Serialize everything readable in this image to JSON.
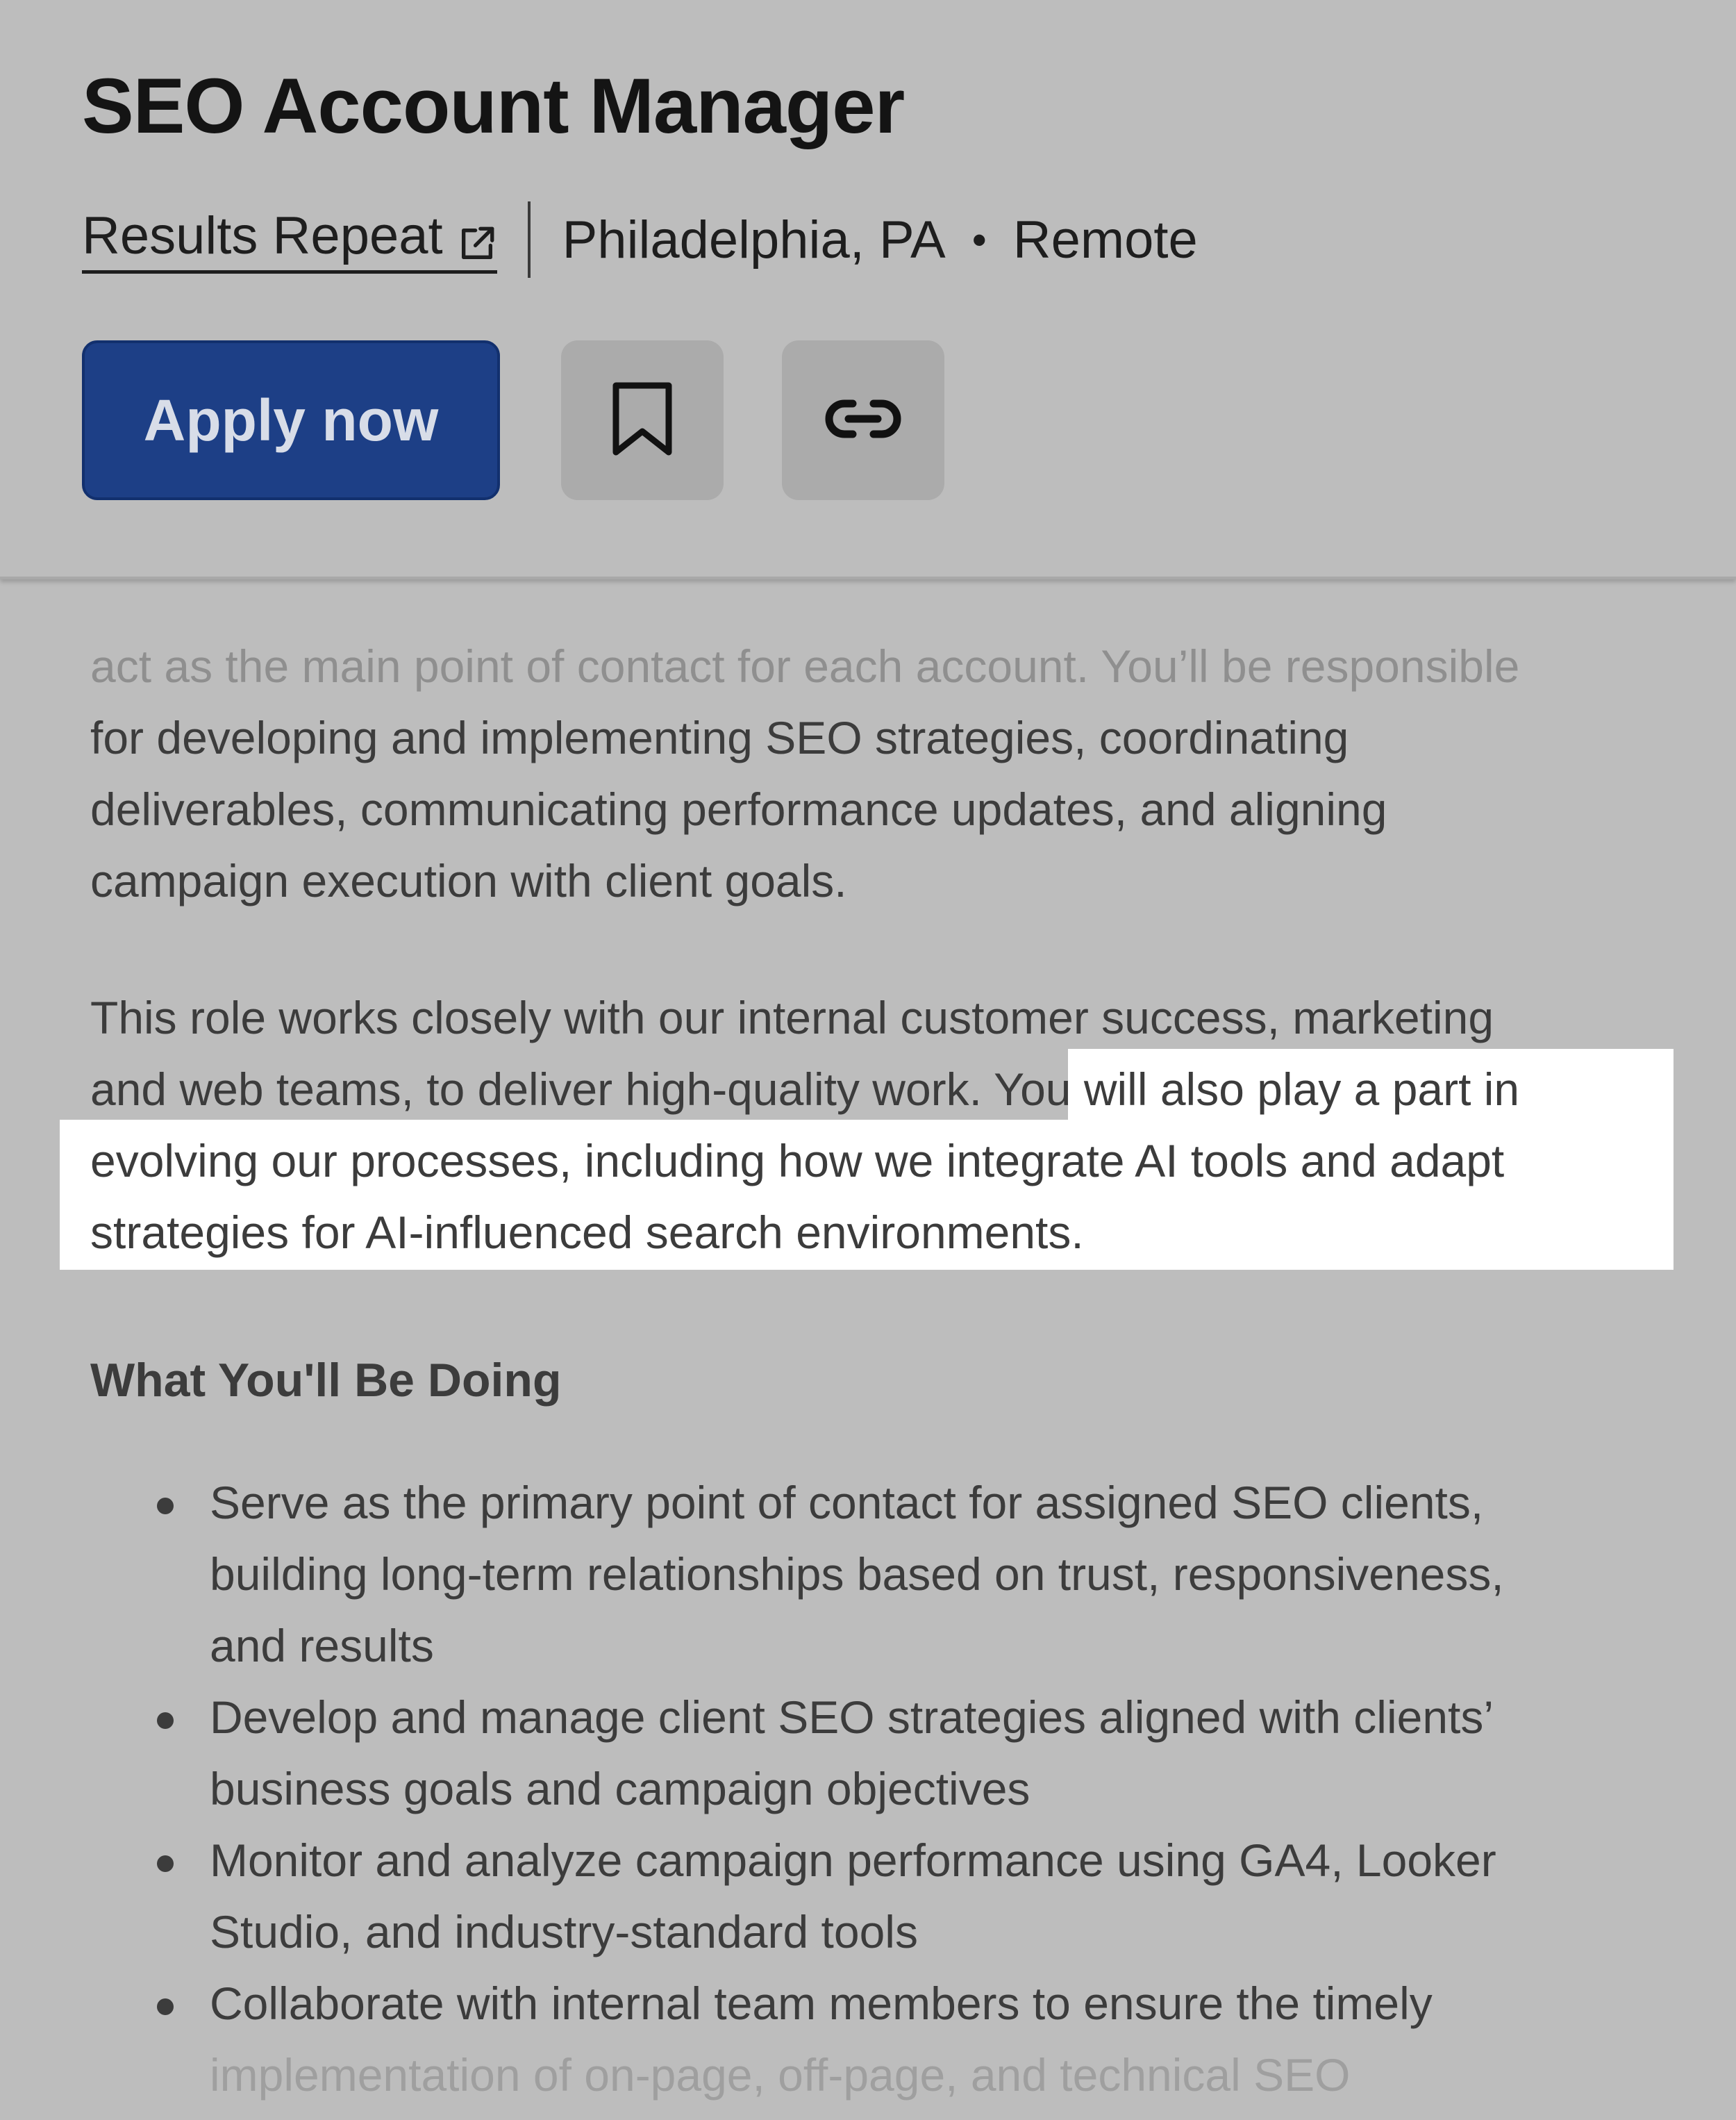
{
  "job": {
    "title": "SEO Account Manager",
    "company": "Results Repeat",
    "location": "Philadelphia, PA",
    "separator": "•",
    "work_type": "Remote"
  },
  "actions": {
    "apply_label": "Apply now",
    "bookmark_icon": "bookmark-icon",
    "link_icon": "link-icon",
    "external_icon": "external-link-icon"
  },
  "description": {
    "intro_faded": "act as the main point of contact for each account. You’ll be responsible",
    "intro_rest_1": "for developing and implementing SEO strategies, coordinating",
    "intro_rest_2": "deliverables, communicating performance updates, and aligning",
    "intro_rest_3": "campaign execution with client goals.",
    "role_line_1": "This role works closely with our internal customer success, marketing",
    "role_line_2_plain": "and web teams, to deliver high-quality work.",
    "role_line_2_highlight": "You will also play a part in",
    "role_line_3": "evolving our processes, including how we integrate AI tools and adapt",
    "role_line_4": "strategies for AI-influenced search environments."
  },
  "section": {
    "heading": "What You'll Be Doing",
    "bullets": [
      {
        "lines": [
          "Serve as the primary point of contact for assigned SEO clients,",
          "building long-term relationships based on trust, responsiveness,",
          "and results"
        ]
      },
      {
        "lines": [
          "Develop and manage client SEO strategies aligned with clients’",
          "business goals and campaign objectives"
        ]
      },
      {
        "lines": [
          "Monitor and analyze campaign performance using GA4, Looker",
          "Studio, and industry-standard tools"
        ]
      },
      {
        "lines": [
          "Collaborate with internal team members to ensure the timely",
          "implementation of on-page, off-page, and technical SEO"
        ]
      }
    ]
  },
  "colors": {
    "background": "#bdbdbd",
    "apply_button": "#1d3f86",
    "highlight": "#ffffff",
    "text": "#3c3c3c"
  }
}
